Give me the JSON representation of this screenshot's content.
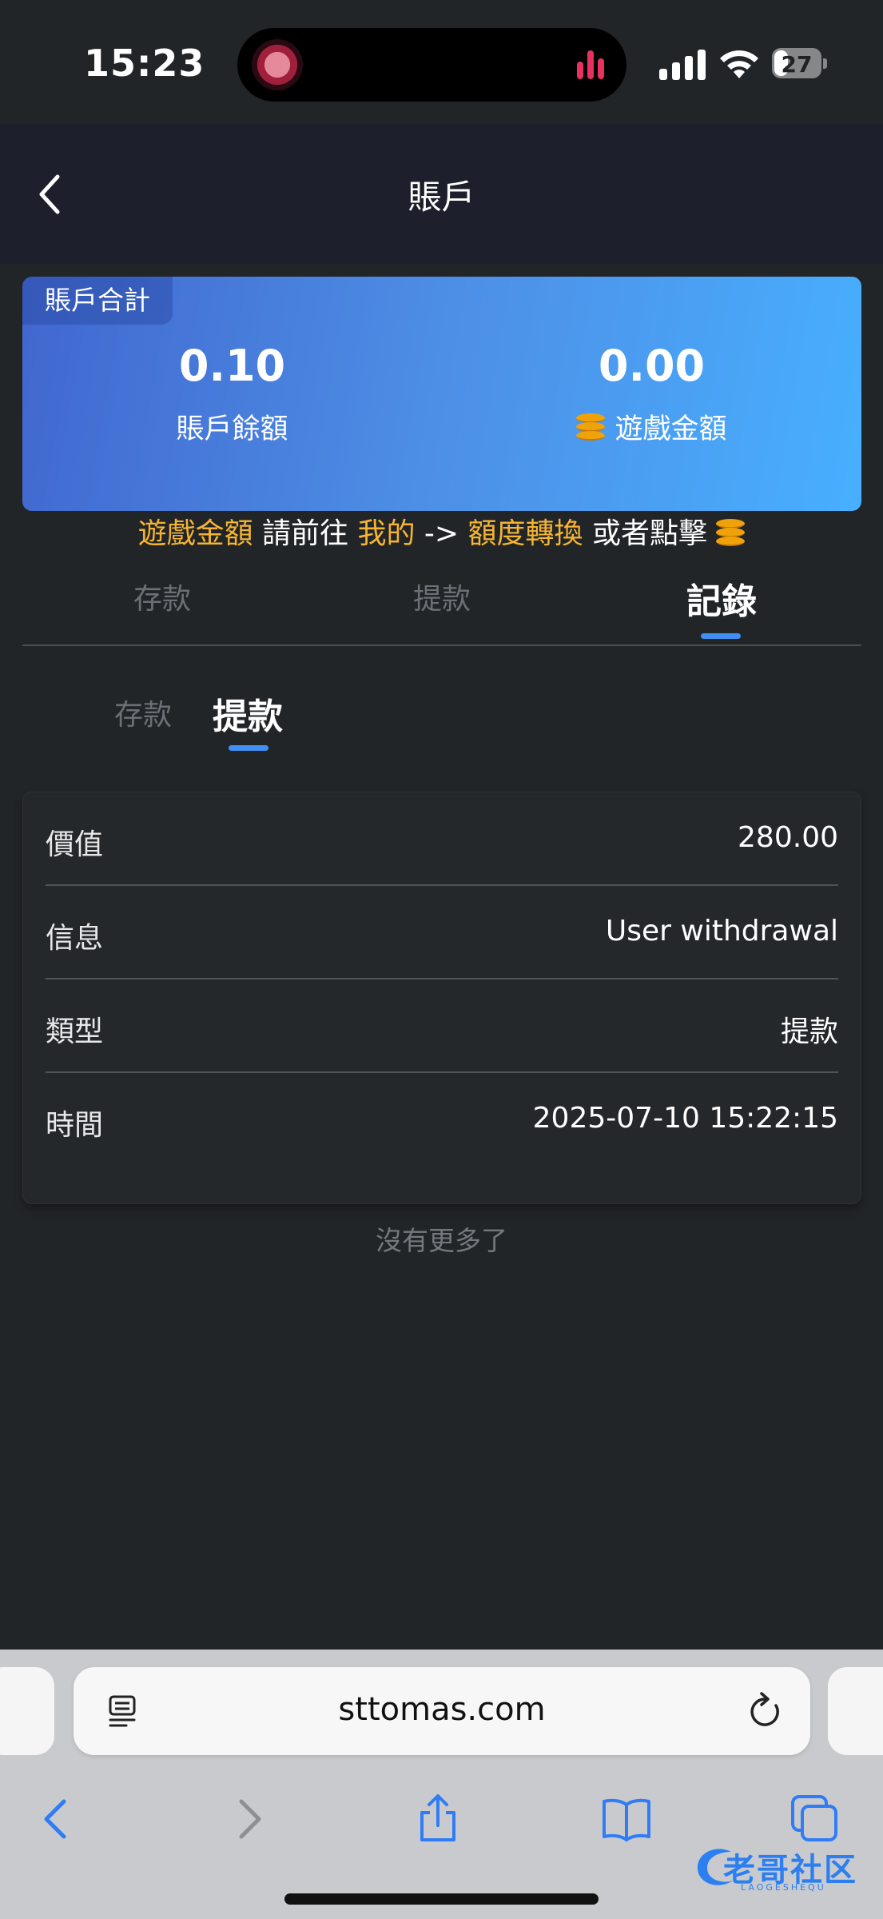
{
  "status": {
    "time": "15:23",
    "battery": "27"
  },
  "header": {
    "title": "賬戶"
  },
  "card": {
    "tag": "賬戶合計",
    "balance_value": "0.10",
    "balance_label": "賬戶餘額",
    "game_value": "0.00",
    "game_label": "遊戲金額"
  },
  "hint": {
    "part1": "遊戲金額",
    "part2": " 請前往 ",
    "part3": "我的",
    "part4": " -> ",
    "part5": "額度轉換",
    "part6": " 或者點擊 "
  },
  "tabs": [
    "存款",
    "提款",
    "記錄"
  ],
  "active_tab": "記錄",
  "subtabs": [
    "存款",
    "提款"
  ],
  "active_subtab": "提款",
  "record": {
    "rows": [
      {
        "key": "價值",
        "value": "280.00"
      },
      {
        "key": "信息",
        "value": "User withdrawal"
      },
      {
        "key": "類型",
        "value": "提款"
      },
      {
        "key": "時間",
        "value": "2025-07-10 15:22:15"
      }
    ]
  },
  "no_more": "沒有更多了",
  "browser": {
    "url": "sttomas.com"
  },
  "watermark": {
    "text": "老哥社区",
    "sub": "LAOGESHEQU"
  },
  "colors": {
    "accent": "#3f8ff4",
    "highlight": "#f5b533",
    "background": "#222527",
    "header": "#1d202c"
  }
}
